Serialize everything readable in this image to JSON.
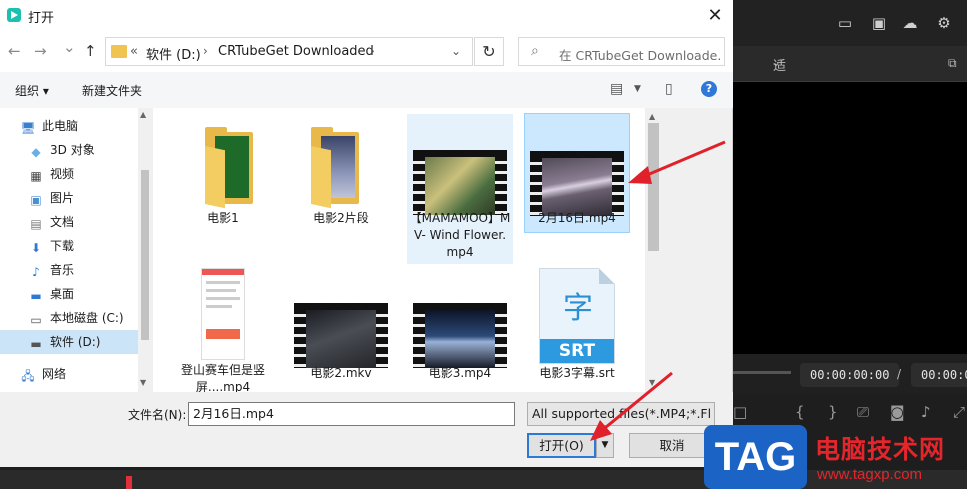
{
  "dialog": {
    "title": "打开",
    "close": "✕"
  },
  "nav": {
    "back": "←",
    "forward": "→",
    "dropdown": "⌄",
    "up": "↑"
  },
  "address": {
    "prefix": "«",
    "drive": "软件 (D:)",
    "folder": "CRTubeGet Downloaded"
  },
  "search": {
    "placeholder": "在 CRTubeGet Downloade..."
  },
  "toolbar": {
    "organize": "组织 ▾",
    "new_folder": "新建文件夹",
    "help": "?"
  },
  "sidebar": {
    "items": [
      {
        "label": "此电脑",
        "icon": "computer-icon"
      },
      {
        "label": "3D 对象",
        "icon": "cube-icon"
      },
      {
        "label": "视频",
        "icon": "video-icon"
      },
      {
        "label": "图片",
        "icon": "picture-icon"
      },
      {
        "label": "文档",
        "icon": "document-icon"
      },
      {
        "label": "下载",
        "icon": "download-icon"
      },
      {
        "label": "音乐",
        "icon": "music-icon"
      },
      {
        "label": "桌面",
        "icon": "desktop-icon"
      },
      {
        "label": "本地磁盘 (C:)",
        "icon": "disk-icon"
      },
      {
        "label": "软件 (D:)",
        "icon": "drive-icon"
      },
      {
        "label": "网络",
        "icon": "network-icon"
      }
    ]
  },
  "files": [
    {
      "name": "电影1"
    },
    {
      "name": "电影2片段"
    },
    {
      "name": "【MAMAMOO】MV- Wind Flower.mp4"
    },
    {
      "name": "2月16日.mp4"
    },
    {
      "name": "登山赛车但是竖屏....mp4"
    },
    {
      "name": "电影2.mkv"
    },
    {
      "name": "电影3.mp4"
    },
    {
      "name": "电影3字幕.srt"
    }
  ],
  "srt_icon": {
    "glyph": "字",
    "band": "SRT"
  },
  "bottom": {
    "filename_label": "文件名(N):",
    "filename_value": "2月16日.mp4",
    "filter": "All supported files(*.MP4;*.Fl",
    "open": "打开(O)",
    "cancel": "取消"
  },
  "editor": {
    "dropdown_label": "适",
    "time_current": "00:00:00:00",
    "time_total": "00:00:00:0",
    "slash": "/"
  },
  "watermark": {
    "logo": "TAG",
    "title": "电脑技术网",
    "url": "www.tagxp.com"
  },
  "colors": {
    "accent": "#2d7ad6",
    "annotation_arrow": "#e0202a",
    "watermark_red": "#e2262b",
    "watermark_blue": "#1c63c6"
  }
}
